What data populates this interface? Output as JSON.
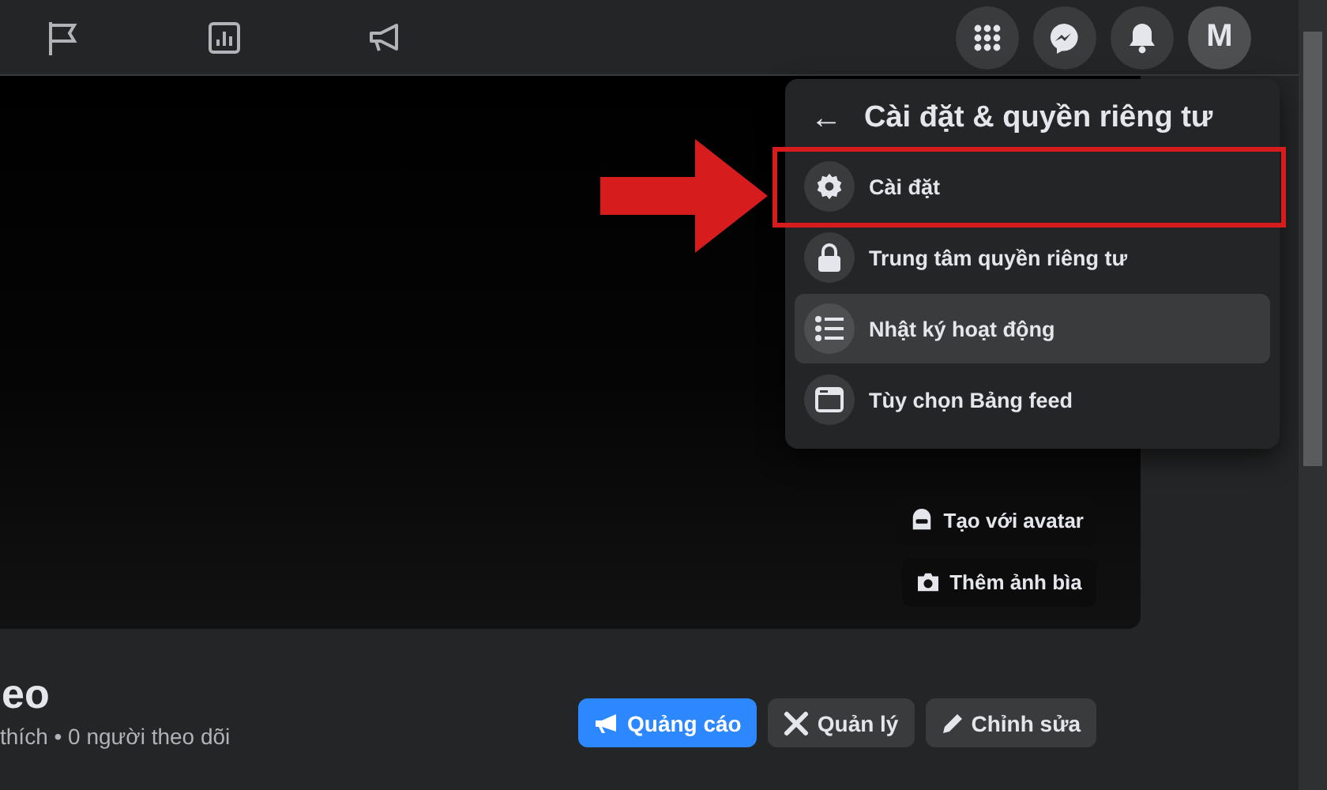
{
  "top_bar": {
    "nav_tabs": [
      {
        "kind": "flag"
      },
      {
        "kind": "chart"
      },
      {
        "kind": "megaphone"
      }
    ],
    "avatar_letter": "M"
  },
  "menu": {
    "back_icon": "←",
    "title": "Cài đặt & quyền riêng tư",
    "items": [
      {
        "kind": "gear",
        "label": "Cài đặt",
        "highlighted": false,
        "framed": true
      },
      {
        "kind": "lock",
        "label": "Trung tâm quyền riêng tư",
        "highlighted": false,
        "framed": false
      },
      {
        "kind": "list",
        "label": "Nhật ký hoạt động",
        "highlighted": true,
        "framed": false
      },
      {
        "kind": "feed",
        "label": "Tùy chọn Bảng feed",
        "highlighted": false,
        "framed": false
      }
    ]
  },
  "pointer_arrow": true,
  "cover": {
    "buttons": [
      {
        "kind": "avatar",
        "label": "Tạo với avatar"
      },
      {
        "kind": "camera",
        "label": "Thêm ảnh bìa"
      }
    ]
  },
  "profile": {
    "name": "eo",
    "stats": "thích • 0 người theo dõi",
    "buttons": [
      {
        "kind": "megaphone",
        "label": "Quảng cáo",
        "primary": true
      },
      {
        "kind": "tools",
        "label": "Quản lý",
        "primary": false
      },
      {
        "kind": "pencil",
        "label": "Chỉnh sửa",
        "primary": false
      }
    ]
  }
}
